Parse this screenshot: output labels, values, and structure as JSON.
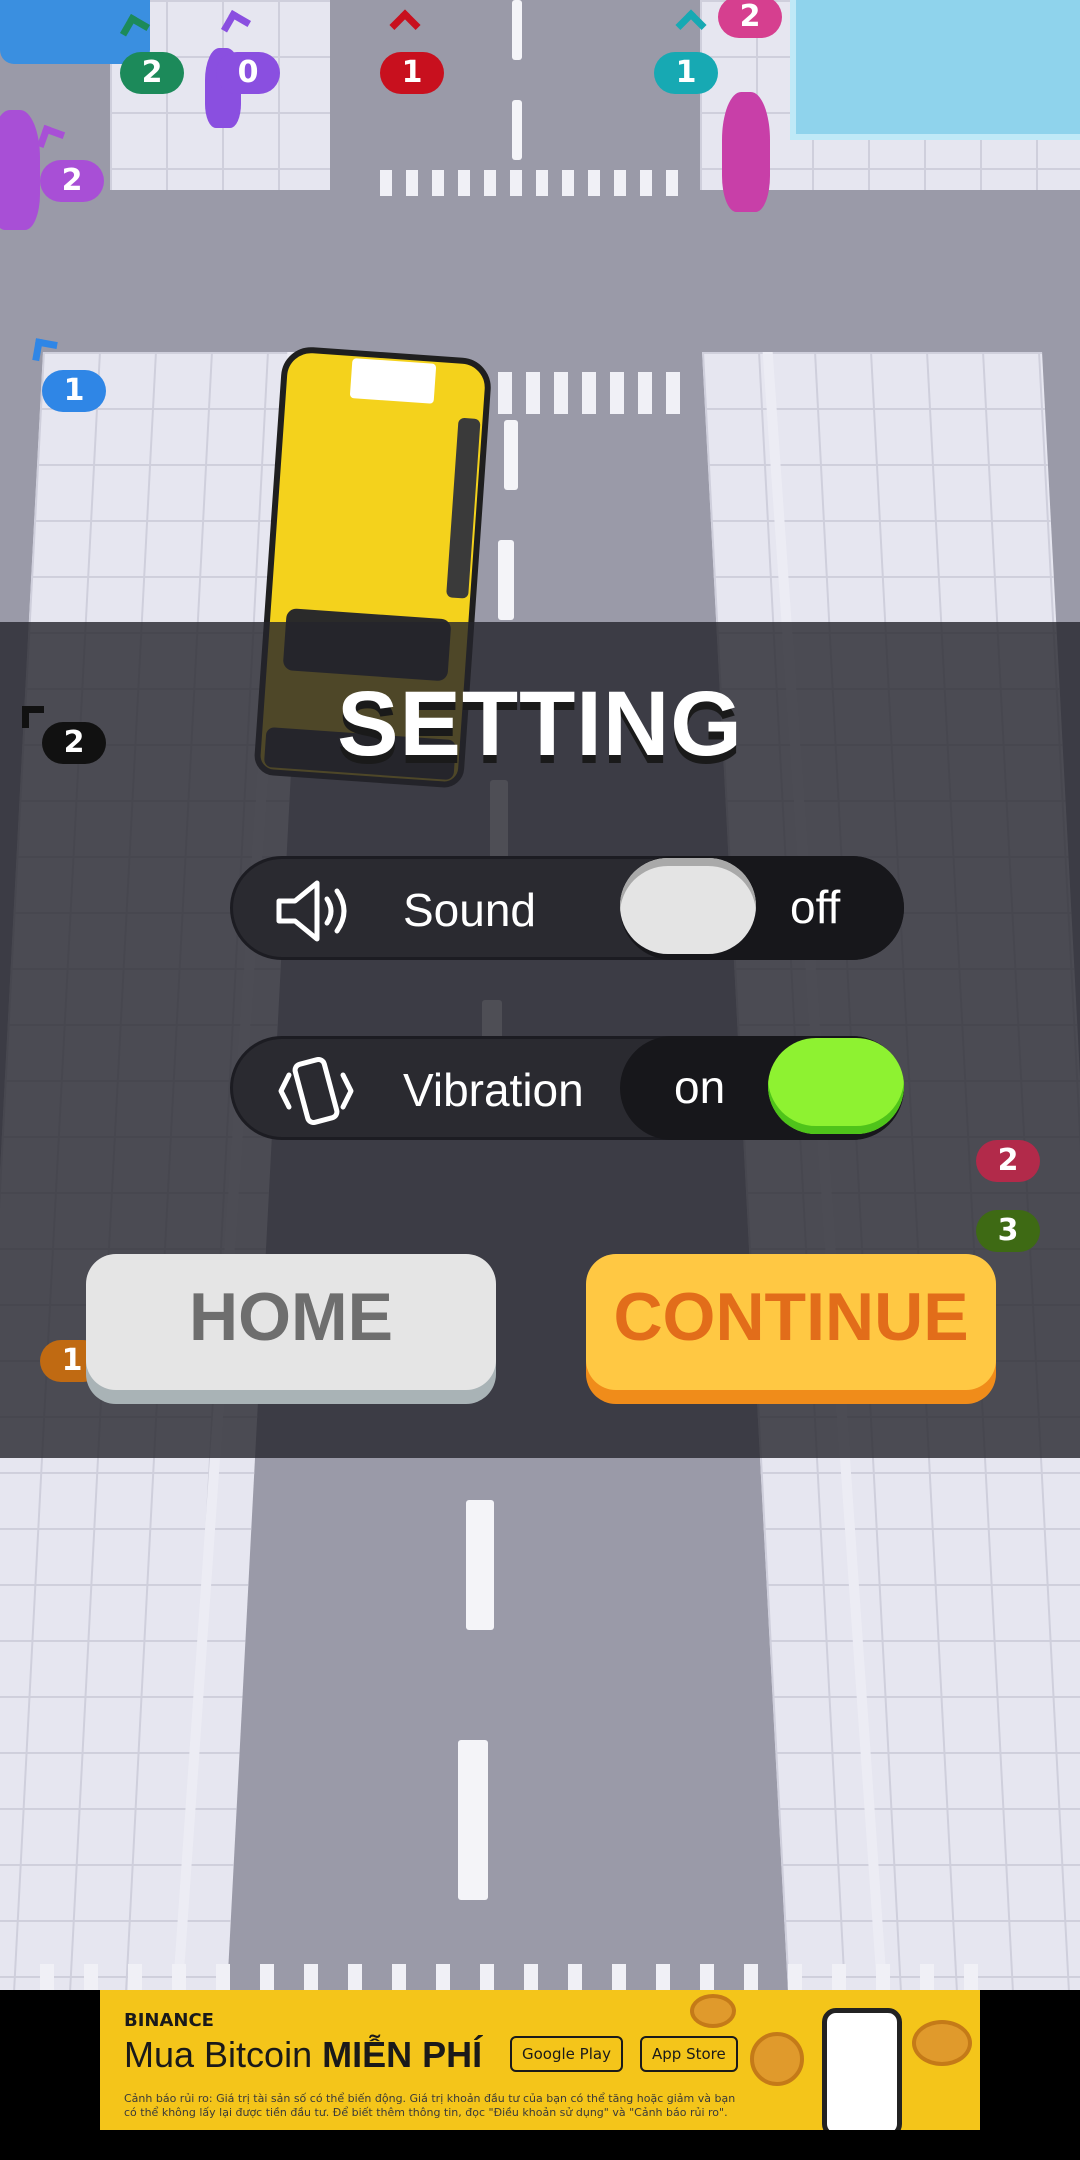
{
  "scene": {
    "player_tags": [
      {
        "value": "2",
        "color": "#1c8a5a"
      },
      {
        "value": "0",
        "color": "#8a4fe0"
      },
      {
        "value": "1",
        "color": "#c8101e"
      },
      {
        "value": "1",
        "color": "#17a9b3"
      },
      {
        "value": "2",
        "color": "#d63f8f"
      },
      {
        "value": "2",
        "color": "#a84fd6"
      },
      {
        "value": "1",
        "color": "#2f86e6"
      },
      {
        "value": "2",
        "color": "#111111"
      },
      {
        "value": "2",
        "color": "#b22a4a"
      },
      {
        "value": "3",
        "color": "#3e6a14"
      },
      {
        "value": "1",
        "color": "#c06a12"
      }
    ]
  },
  "settings": {
    "title": "SETTING",
    "sound": {
      "label": "Sound",
      "state": "off",
      "icon": "speaker-icon",
      "enabled": false
    },
    "vibration": {
      "label": "Vibration",
      "state": "on",
      "icon": "vibration-icon",
      "enabled": true
    },
    "home_label": "HOME",
    "continue_label": "CONTINUE"
  },
  "ad": {
    "brand": "BINANCE",
    "headline_prefix": "Mua Bitcoin ",
    "headline_bold": "MIỄN PHÍ",
    "google_play": "Google Play",
    "app_store": "App Store",
    "fine_print": "Cảnh báo rủi ro: Giá trị tài sản số có thể biến động. Giá trị khoản đầu tư của bạn có thể tăng hoặc giảm và bạn có thể không lấy lại được tiền đầu tư. Để biết thêm thông tin, đọc \"Điều khoản sử dụng\" và \"Cảnh báo rủi ro\"."
  },
  "colors": {
    "toggle_on": "#8ef231",
    "toggle_off": "#e4e4e4",
    "continue_bg": "#ffc843",
    "continue_text": "#e26d1a",
    "home_bg": "#e5e5e5"
  }
}
